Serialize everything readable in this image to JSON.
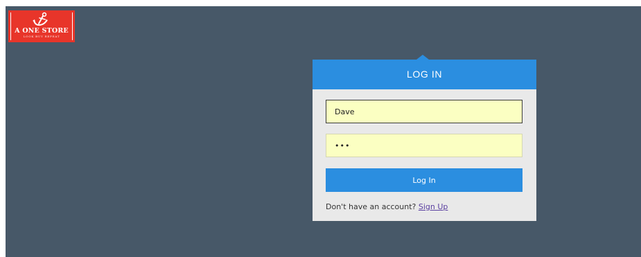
{
  "brand": {
    "name": "A ONE STORE",
    "tagline": "LOOK BUY REPEAT",
    "logo_icon": "anchor-icon",
    "color": "#e8352a"
  },
  "login": {
    "title": "LOG IN",
    "username_value": "Dave",
    "password_value": "abc",
    "button_label": "Log In",
    "signup_prompt": "Don't have an account?",
    "signup_link": "Sign Up",
    "accent": "#2b8ee0",
    "field_background": "#fbffc2"
  },
  "page": {
    "background": "#475868"
  }
}
